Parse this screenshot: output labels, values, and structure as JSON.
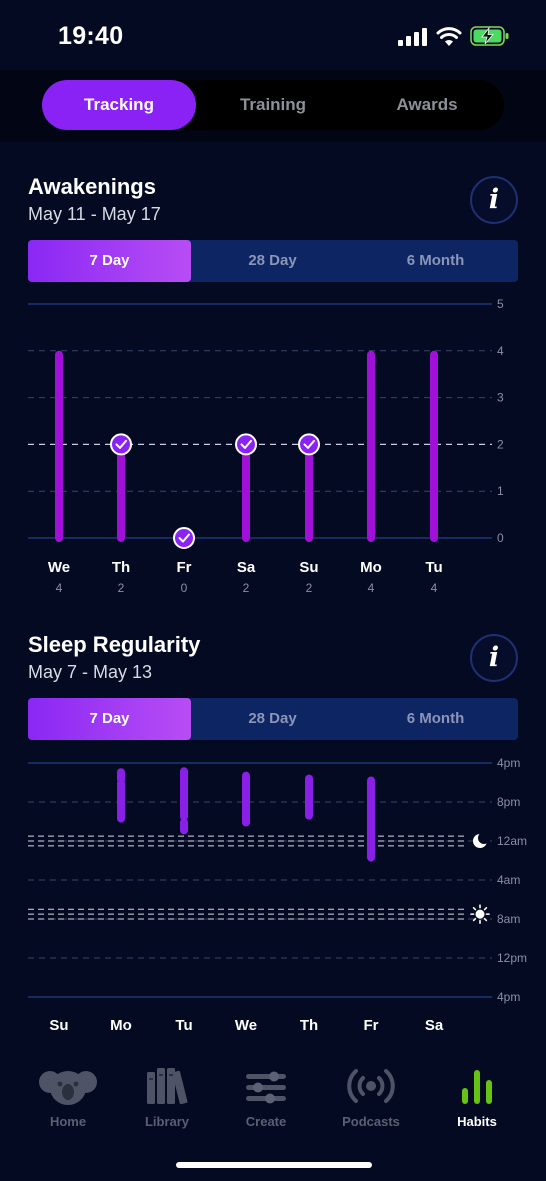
{
  "status": {
    "time": "19:40"
  },
  "top_tabs": [
    {
      "label": "Tracking",
      "active": true
    },
    {
      "label": "Training",
      "active": false
    },
    {
      "label": "Awards",
      "active": false
    }
  ],
  "awakenings": {
    "title": "Awakenings",
    "date_range": "May 11 - May 17",
    "info_label": "i",
    "ranges": [
      {
        "label": "7 Day",
        "active": true
      },
      {
        "label": "28 Day",
        "active": false
      },
      {
        "label": "6 Month",
        "active": false
      }
    ]
  },
  "regularity": {
    "title": "Sleep Regularity",
    "date_range": "May 7 - May 13",
    "info_label": "i",
    "ranges": [
      {
        "label": "7 Day",
        "active": true
      },
      {
        "label": "28 Day",
        "active": false
      },
      {
        "label": "6 Month",
        "active": false
      }
    ]
  },
  "chart_data": [
    {
      "type": "bar",
      "categories": [
        "We",
        "Th",
        "Fr",
        "Sa",
        "Su",
        "Mo",
        "Tu"
      ],
      "values": [
        4,
        2,
        0,
        2,
        2,
        4,
        4
      ],
      "goal_met": [
        false,
        true,
        true,
        true,
        true,
        false,
        false
      ],
      "goal_line": 2,
      "ylim": [
        0,
        5
      ],
      "yticks": [
        "0",
        "1",
        "2",
        "3",
        "4",
        "5"
      ],
      "bar_color": "#a010d8"
    },
    {
      "type": "bar",
      "categories": [
        "Su",
        "Mo",
        "Tu",
        "We",
        "Th",
        "Fr",
        "Sa"
      ],
      "yticks": [
        "4pm",
        "8pm",
        "12am",
        "4am",
        "8am",
        "12pm",
        "4pm"
      ],
      "sleep_segments": [
        [],
        [
          [
            0.95,
            1.7
          ],
          [
            2.1,
            5.3
          ],
          [
            5.45,
            5.7
          ]
        ],
        [
          [
            0.85,
            5.5
          ],
          [
            6.1,
            6.9
          ]
        ],
        [
          [
            1.3,
            5.0
          ],
          [
            5.2,
            6.1
          ]
        ],
        [
          [
            1.6,
            5.4
          ]
        ],
        [
          [
            1.8,
            9.7
          ]
        ],
        []
      ],
      "typical_bedtime": [
        23.5,
        0.5
      ],
      "typical_wake": [
        7.0,
        8.0
      ],
      "bedtime_icon": "moon-icon",
      "wake_icon": "sun-icon",
      "bar_color": "#8a20e8"
    }
  ],
  "nav": [
    {
      "label": "Home",
      "icon": "koala-icon",
      "active": false
    },
    {
      "label": "Library",
      "icon": "books-icon",
      "active": false
    },
    {
      "label": "Create",
      "icon": "sliders-icon",
      "active": false
    },
    {
      "label": "Podcasts",
      "icon": "podcast-icon",
      "active": false
    },
    {
      "label": "Habits",
      "icon": "bar-chart-icon",
      "active": true
    }
  ],
  "colors": {
    "accent": "#8b22f5",
    "habits": "#66c214",
    "background": "#040a22"
  }
}
